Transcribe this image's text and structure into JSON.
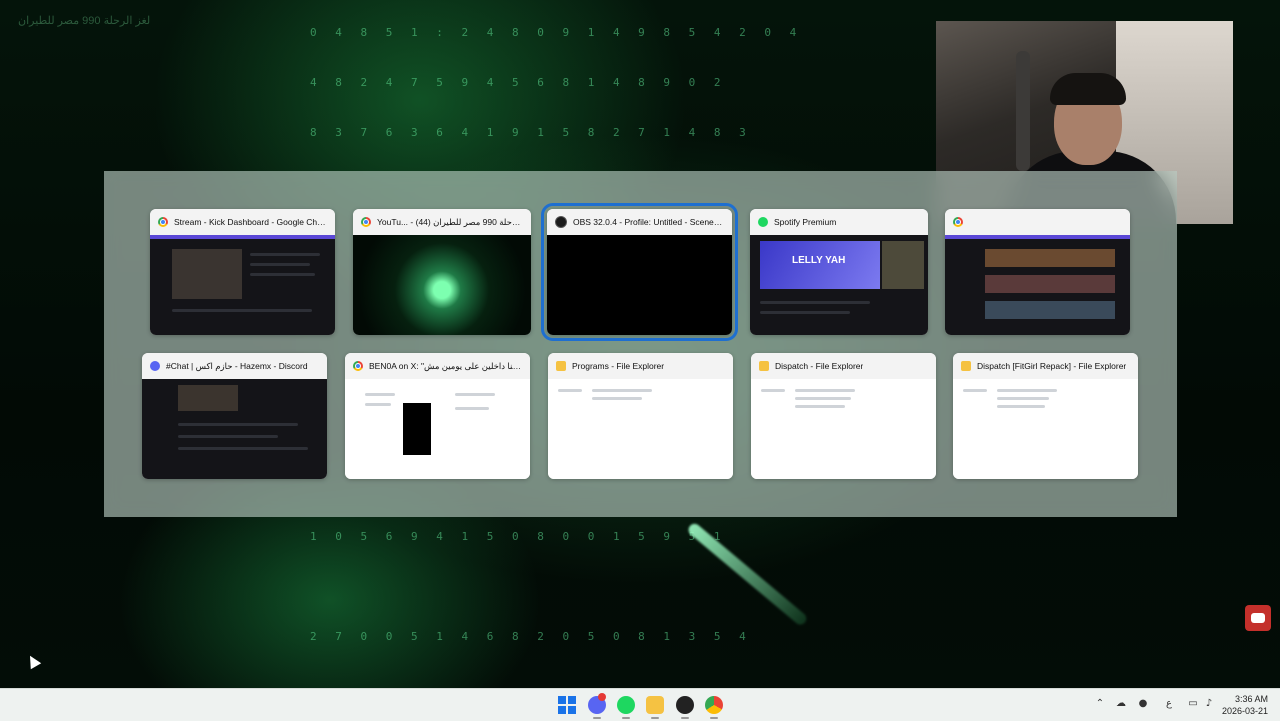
{
  "background": {
    "corner_text": "لغز الرحلة 990 مصر للطيران",
    "code_rows": [
      "0 4 8 5 1 : 2 4 8 0 9 1 4 9 8 5 4 2 0 4",
      "4 8 2 4 7 5 9 4 5 6 8 1 4 8 9 0 2",
      "8 3 7 6 3 6 4 1 9 1 5 8 2 7 1 4 8 3",
      "1 0 5 6 9 4 1 5 0 8 0 0 1 5 9 5 1",
      "2 7 0 0 5 1 4 6 8 2 0 5 0 8 1 3 5 4"
    ]
  },
  "switcher": {
    "windows": [
      {
        "title": "Stream - Kick Dashboard - Google Chrome",
        "icon": "chrome-icon"
      },
      {
        "title": "YouTu... - لغز الرحلة 990 مصر للطيران (44)",
        "icon": "chrome-icon"
      },
      {
        "title": "OBS 32.0.4 - Profile: Untitled - Scenes: U...",
        "icon": "obs-icon",
        "selected": true
      },
      {
        "title": "Spotify Premium",
        "icon": "spotify-icon"
      },
      {
        "title": "",
        "icon": "chrome-icon"
      },
      {
        "title": "#Chat | حازم اكس - Hazemx - Discord",
        "icon": "discord-icon"
      },
      {
        "title": "BEN0A on X: \"شكلنا داخلين على يومين مش...",
        "icon": "chrome-icon"
      },
      {
        "title": "Programs - File Explorer",
        "icon": "folder-icon"
      },
      {
        "title": "Dispatch - File Explorer",
        "icon": "folder-icon"
      },
      {
        "title": "Dispatch [FitGirl Repack] - File Explorer",
        "icon": "folder-icon"
      }
    ],
    "spotify_artist": "LELLY YAH"
  },
  "taskbar": {
    "apps": [
      "start-icon",
      "discord-icon",
      "spotify-icon",
      "file-explorer-icon",
      "obs-icon",
      "chrome-icon"
    ],
    "tray_lang": "ع",
    "time": "3:36 AM",
    "date": "2026-03-21"
  },
  "colors": {
    "selection": "#1e6fd0",
    "accent_green": "#3cff8a"
  }
}
